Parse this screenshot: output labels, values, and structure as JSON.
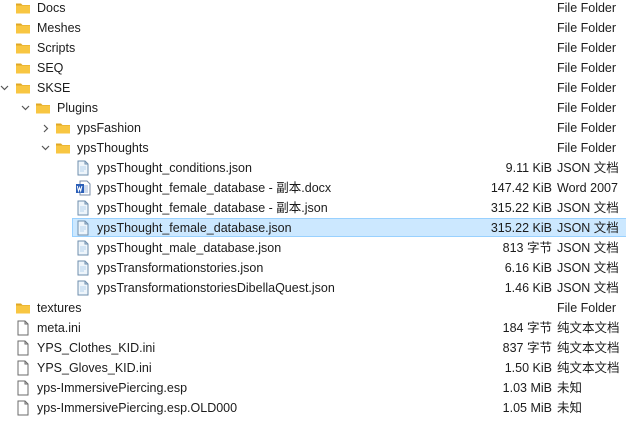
{
  "tree": {
    "rows": [
      {
        "name": "Docs",
        "size": "",
        "type": "File Folder",
        "kind": "folder",
        "level": 0,
        "chevron": "",
        "selected": false
      },
      {
        "name": "Meshes",
        "size": "",
        "type": "File Folder",
        "kind": "folder",
        "level": 0,
        "chevron": "",
        "selected": false
      },
      {
        "name": "Scripts",
        "size": "",
        "type": "File Folder",
        "kind": "folder",
        "level": 0,
        "chevron": "",
        "selected": false
      },
      {
        "name": "SEQ",
        "size": "",
        "type": "File Folder",
        "kind": "folder",
        "level": 0,
        "chevron": "",
        "selected": false
      },
      {
        "name": "SKSE",
        "size": "",
        "type": "File Folder",
        "kind": "folder",
        "level": 0,
        "chevron": "expanded",
        "selected": false
      },
      {
        "name": "Plugins",
        "size": "",
        "type": "File Folder",
        "kind": "folder",
        "level": 1,
        "chevron": "expanded",
        "selected": false
      },
      {
        "name": "ypsFashion",
        "size": "",
        "type": "File Folder",
        "kind": "folder",
        "level": 2,
        "chevron": "collapsed",
        "selected": false
      },
      {
        "name": "ypsThoughts",
        "size": "",
        "type": "File Folder",
        "kind": "folder",
        "level": 2,
        "chevron": "expanded",
        "selected": false
      },
      {
        "name": "ypsThought_conditions.json",
        "size": "9.11 KiB",
        "type": "JSON 文档",
        "kind": "json",
        "level": 3,
        "chevron": "",
        "selected": false
      },
      {
        "name": "ypsThought_female_database - 副本.docx",
        "size": "147.42 KiB",
        "type": "Word 2007",
        "kind": "docx",
        "level": 3,
        "chevron": "",
        "selected": false
      },
      {
        "name": "ypsThought_female_database - 副本.json",
        "size": "315.22 KiB",
        "type": "JSON 文档",
        "kind": "json",
        "level": 3,
        "chevron": "",
        "selected": false
      },
      {
        "name": "ypsThought_female_database.json",
        "size": "315.22 KiB",
        "type": "JSON 文档",
        "kind": "json",
        "level": 3,
        "chevron": "",
        "selected": true
      },
      {
        "name": "ypsThought_male_database.json",
        "size": "813 字节",
        "type": "JSON 文档",
        "kind": "json",
        "level": 3,
        "chevron": "",
        "selected": false
      },
      {
        "name": "ypsTransformationstories.json",
        "size": "6.16 KiB",
        "type": "JSON 文档",
        "kind": "json",
        "level": 3,
        "chevron": "",
        "selected": false
      },
      {
        "name": "ypsTransformationstoriesDibellaQuest.json",
        "size": "1.46 KiB",
        "type": "JSON 文档",
        "kind": "json",
        "level": 3,
        "chevron": "",
        "selected": false
      },
      {
        "name": "textures",
        "size": "",
        "type": "File Folder",
        "kind": "folder",
        "level": 0,
        "chevron": "",
        "selected": false
      },
      {
        "name": "meta.ini",
        "size": "184 字节",
        "type": "纯文本文档",
        "kind": "file",
        "level": 0,
        "chevron": "",
        "selected": false
      },
      {
        "name": "YPS_Clothes_KID.ini",
        "size": "837 字节",
        "type": "纯文本文档",
        "kind": "file",
        "level": 0,
        "chevron": "",
        "selected": false
      },
      {
        "name": "YPS_Gloves_KID.ini",
        "size": "1.50 KiB",
        "type": "纯文本文档",
        "kind": "file",
        "level": 0,
        "chevron": "",
        "selected": false
      },
      {
        "name": "yps-ImmersivePiercing.esp",
        "size": "1.03 MiB",
        "type": "未知",
        "kind": "file",
        "level": 0,
        "chevron": "",
        "selected": false
      },
      {
        "name": "yps-ImmersivePiercing.esp.OLD000",
        "size": "1.05 MiB",
        "type": "未知",
        "kind": "file",
        "level": 0,
        "chevron": "",
        "selected": false
      }
    ]
  },
  "colors": {
    "folder": "#f8c642",
    "folder_dark": "#e0a826",
    "selection_bg": "#cce8ff",
    "selection_border": "#99d1ff",
    "json_icon": "#b7d3ec",
    "word_blue": "#2b5fb8"
  },
  "icons": {
    "folder": "folder-icon",
    "json": "json-file-icon",
    "docx": "word-document-icon",
    "file": "blank-file-icon",
    "expanded": "chevron-down-icon",
    "collapsed": "chevron-right-icon"
  }
}
